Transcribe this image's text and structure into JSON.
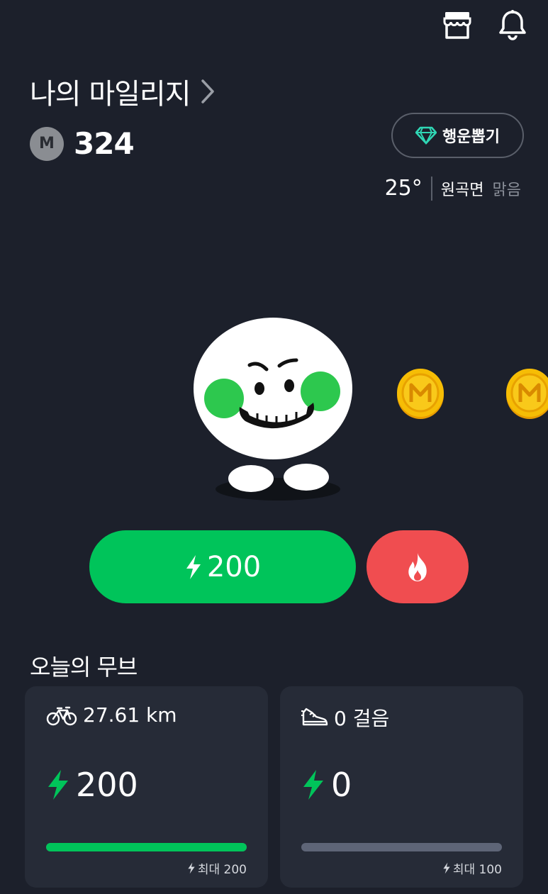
{
  "header": {
    "title": "나의 마일리지",
    "coin_symbol": "M",
    "balance": "324",
    "luck_button_label": "행운뽑기"
  },
  "weather": {
    "temperature": "25°",
    "region": "원곡면",
    "condition": "맑음"
  },
  "coin_symbol": "M",
  "actions": {
    "charge_amount": "200"
  },
  "today": {
    "title": "오늘의 무브",
    "cards": [
      {
        "activity": "27.61 km",
        "icon": "bicycle-icon",
        "value": "200",
        "max_label": "최대 200",
        "progress": 1.0
      },
      {
        "activity": "0 걸음",
        "icon": "sneaker-icon",
        "value": "0",
        "max_label": "최대 100",
        "progress": 0.0
      }
    ]
  },
  "colors": {
    "background": "#1c202b",
    "accent_green": "#00c45a",
    "accent_red": "#f04d50",
    "card": "#262b37",
    "coin": "#f5b800"
  }
}
